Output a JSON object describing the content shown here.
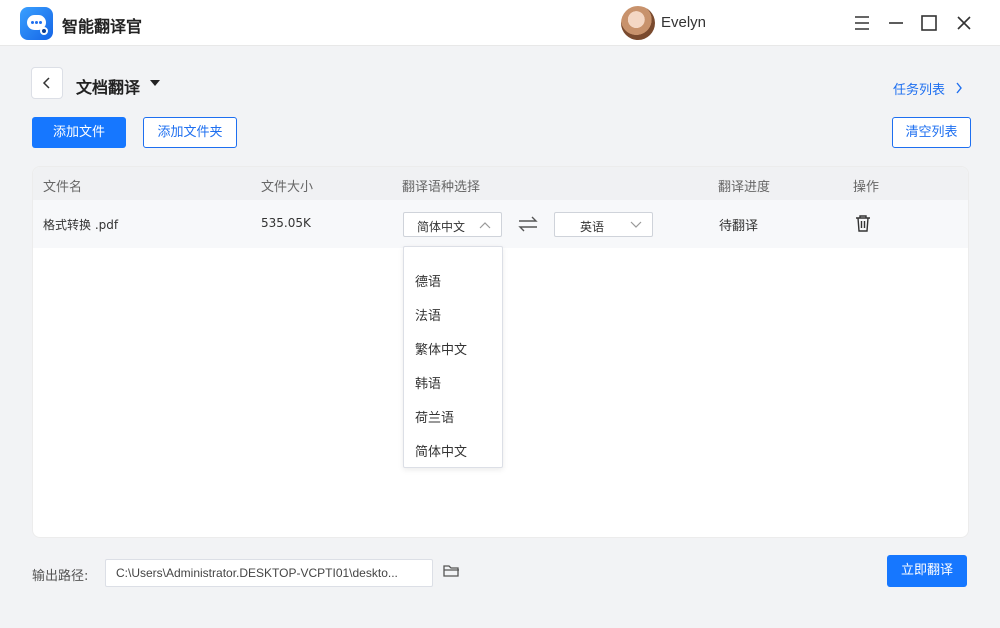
{
  "app": {
    "name": "智能翻译官",
    "username": "Evelyn"
  },
  "header": {
    "title": "文档翻译",
    "task_list_link": "任务列表"
  },
  "toolbar": {
    "add_file": "添加文件",
    "add_folder": "添加文件夹",
    "clear_list": "清空列表"
  },
  "table": {
    "columns": [
      "文件名",
      "文件大小",
      "翻译语种选择",
      "翻译进度",
      "操作"
    ],
    "rows": [
      {
        "file_name": "格式转换 .pdf",
        "file_size": "535.05K",
        "source_lang": "简体中文",
        "target_lang": "英语",
        "status": "待翻译"
      }
    ]
  },
  "dropdown": {
    "options": [
      "德语",
      "法语",
      "繁体中文",
      "韩语",
      "荷兰语",
      "简体中文"
    ]
  },
  "footer": {
    "output_label": "输出路径:",
    "output_path": "C:\\Users\\Administrator.DESKTOP-VCPTI01\\deskto...",
    "translate_button": "立即翻译"
  },
  "colors": {
    "accent": "#1677ff",
    "link": "#1e6ff0"
  }
}
